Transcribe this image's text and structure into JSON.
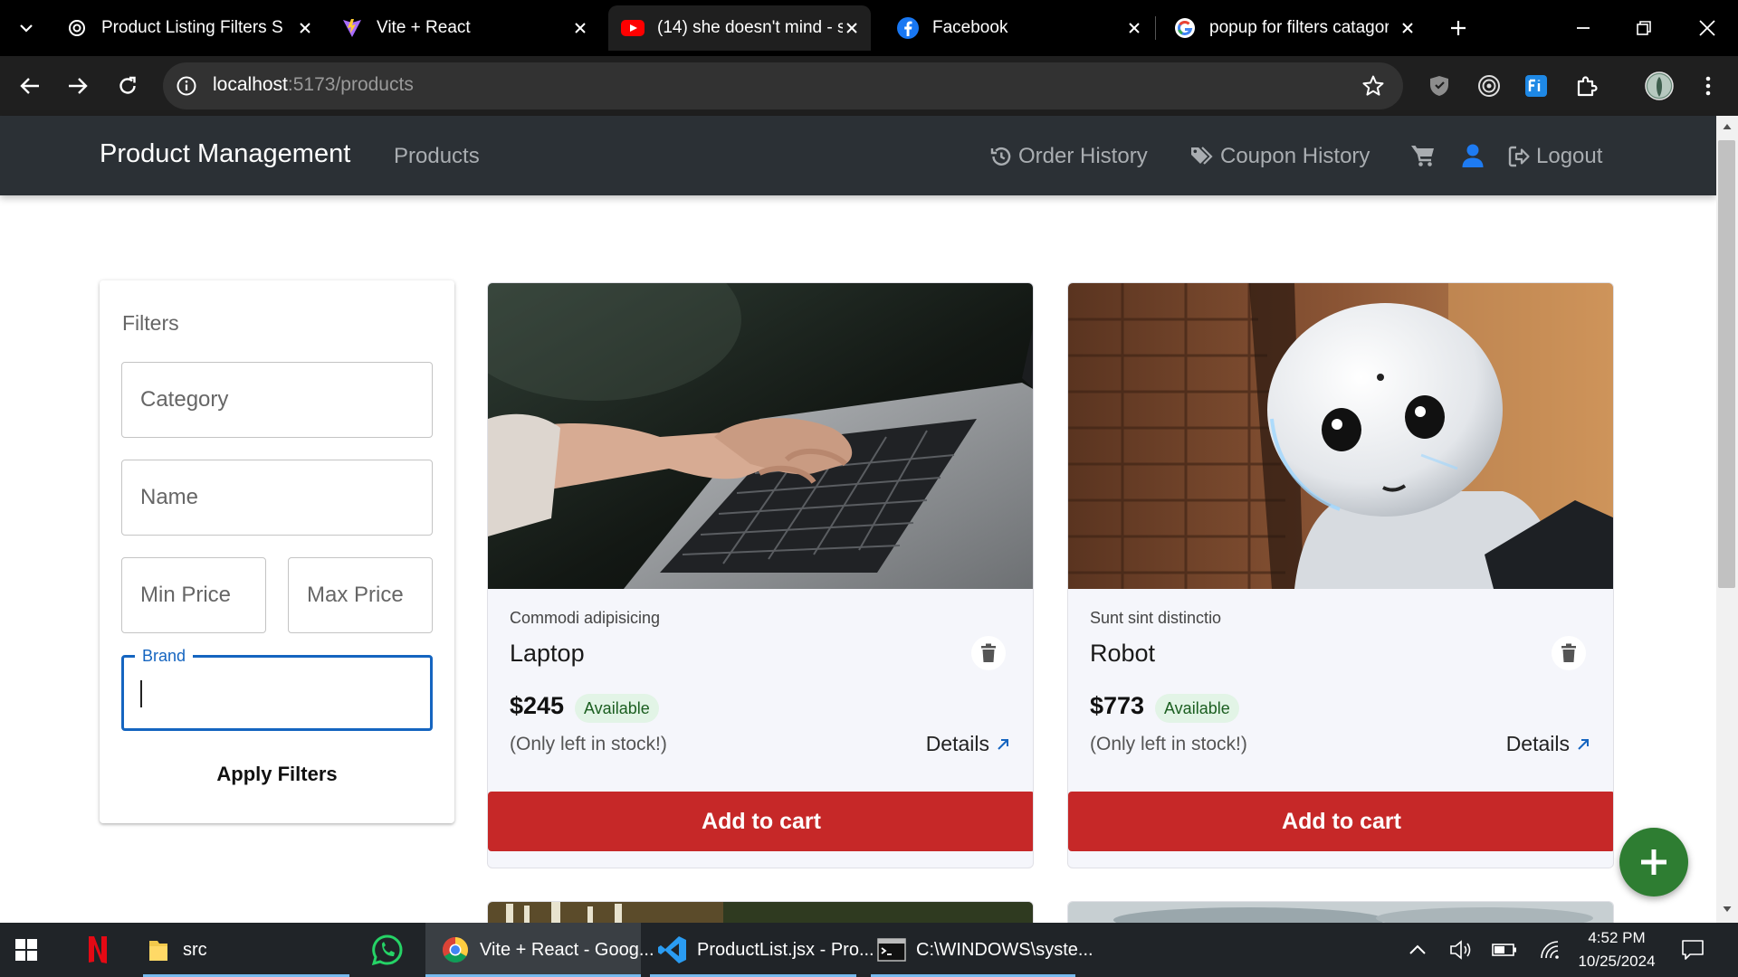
{
  "browser": {
    "tabs": [
      {
        "title": "Product Listing Filters Set",
        "favicon": "chatgpt-icon"
      },
      {
        "title": "Vite + React",
        "favicon": "vite-icon"
      },
      {
        "title": "(14) she doesn't mind - s",
        "favicon": "youtube-icon"
      },
      {
        "title": "Facebook",
        "favicon": "facebook-icon"
      },
      {
        "title": "popup for filters catagory",
        "favicon": "google-icon"
      }
    ],
    "active_tab_index": 1,
    "url_host": "localhost",
    "url_rest": ":5173/products"
  },
  "nav": {
    "brand": "Product Management",
    "products": "Products",
    "order_history": "Order History",
    "coupon_history": "Coupon History",
    "logout": "Logout"
  },
  "filters": {
    "title": "Filters",
    "category_placeholder": "Category",
    "name_placeholder": "Name",
    "min_price_placeholder": "Min Price",
    "max_price_placeholder": "Max Price",
    "brand_label": "Brand",
    "brand_value": "",
    "apply_label": "Apply Filters"
  },
  "products": [
    {
      "brand": "Commodi adipisicing",
      "name": "Laptop",
      "price": "$245",
      "status": "Available",
      "stock_note": "(Only left in stock!)",
      "details_label": "Details",
      "cart_label": "Add to cart"
    },
    {
      "brand": "Sunt sint distinctio",
      "name": "Robot",
      "price": "$773",
      "status": "Available",
      "stock_note": "(Only left in stock!)",
      "details_label": "Details",
      "cart_label": "Add to cart"
    }
  ],
  "taskbar": {
    "items": [
      {
        "label": "src",
        "icon": "folder-icon"
      },
      {
        "label": "Vite + React - Goog...",
        "icon": "chrome-icon"
      },
      {
        "label": "ProductList.jsx - Pro...",
        "icon": "vscode-icon"
      },
      {
        "label": "C:\\WINDOWS\\syste...",
        "icon": "terminal-icon"
      }
    ],
    "time": "4:52 PM",
    "date": "10/25/2024"
  },
  "colors": {
    "navbar_bg": "#2b3035",
    "cart_button": "#c62828",
    "fab": "#2e7d32",
    "focus": "#1565c0",
    "badge_bg": "#e2f4e6",
    "badge_text": "#1b5e20"
  }
}
